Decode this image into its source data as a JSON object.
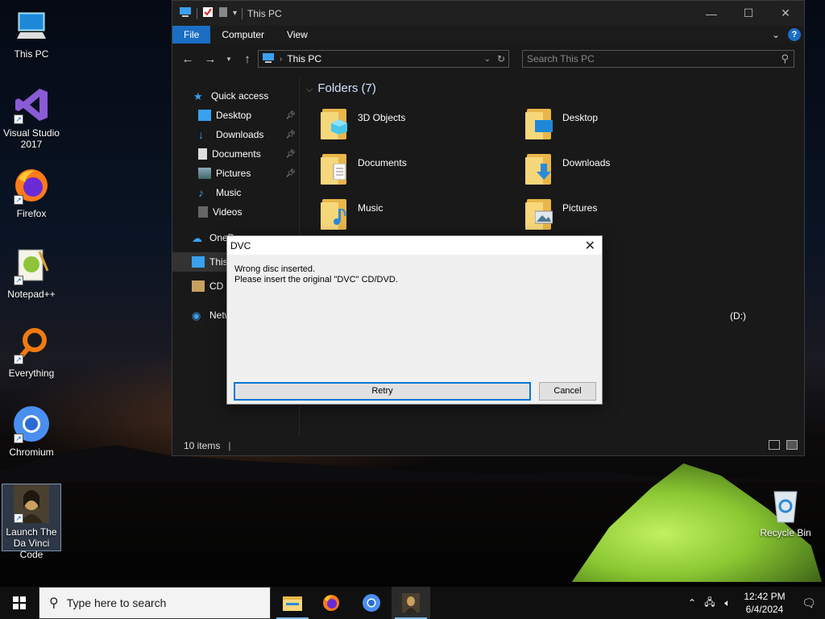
{
  "desktop": {
    "icons": [
      {
        "label": "This PC",
        "icon": "this-pc-icon"
      },
      {
        "label": "Visual Studio 2017",
        "icon": "visual-studio-icon"
      },
      {
        "label": "Firefox",
        "icon": "firefox-icon"
      },
      {
        "label": "Notepad++",
        "icon": "notepadpp-icon"
      },
      {
        "label": "Everything",
        "icon": "everything-icon"
      },
      {
        "label": "Chromium",
        "icon": "chromium-icon"
      },
      {
        "label": "Launch The Da Vinci Code",
        "icon": "mona-lisa-icon"
      }
    ],
    "recycle_bin": "Recycle Bin"
  },
  "explorer": {
    "title": "This PC",
    "ribbon_tabs": [
      "File",
      "Computer",
      "View"
    ],
    "address": "This PC",
    "search_placeholder": "Search This PC",
    "nav": {
      "quick_access": "Quick access",
      "items": [
        {
          "label": "Desktop",
          "pinned": true
        },
        {
          "label": "Downloads",
          "pinned": true
        },
        {
          "label": "Documents",
          "pinned": true
        },
        {
          "label": "Pictures",
          "pinned": true
        },
        {
          "label": "Music",
          "pinned": false
        },
        {
          "label": "Videos",
          "pinned": false
        }
      ],
      "onedrive": "OneD",
      "this_pc": "This",
      "cd_drive": "CD D",
      "network": "Netw"
    },
    "group_header": "Folders (7)",
    "folders": [
      {
        "name": "3D Objects",
        "overlay": "cube"
      },
      {
        "name": "Desktop",
        "overlay": "desktop"
      },
      {
        "name": "Documents",
        "overlay": "document"
      },
      {
        "name": "Downloads",
        "overlay": "arrow-down"
      },
      {
        "name": "Music",
        "overlay": "note"
      },
      {
        "name": "Pictures",
        "overlay": "landscape"
      }
    ],
    "drive_label_partial": "(D:)",
    "status": "10 items"
  },
  "dialog": {
    "title": "DVC",
    "line1": "Wrong disc inserted.",
    "line2": "Please insert the original \"DVC\" CD/DVD.",
    "retry": "Retry",
    "cancel": "Cancel"
  },
  "taskbar": {
    "search_placeholder": "Type here to search",
    "time": "12:42 PM",
    "date": "6/4/2024"
  },
  "colors": {
    "accent": "#1a6ec4",
    "dialog_bg": "#f0f0f0",
    "explorer_bg": "#191919"
  }
}
